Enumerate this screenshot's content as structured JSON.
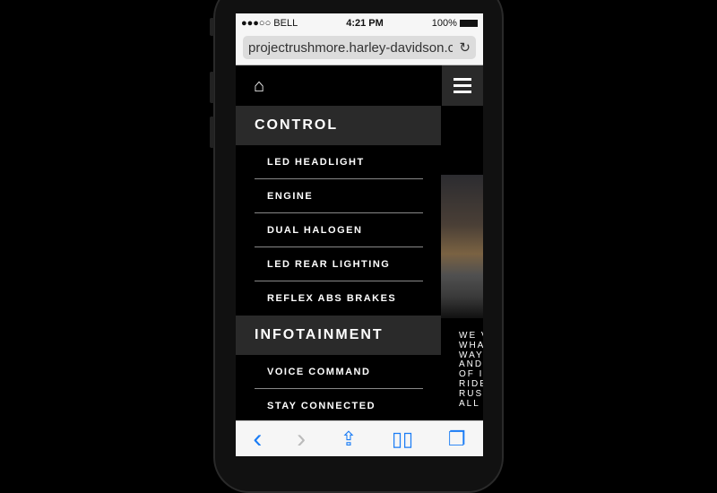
{
  "status_bar": {
    "carrier": "●●●○○ BELL",
    "time": "4:21 PM",
    "battery": "100%"
  },
  "browser": {
    "url": "projectrushmore.harley-davidson.com",
    "reload_icon": "reload-icon"
  },
  "nav": {
    "home_icon": "home-icon",
    "menu_icon": "hamburger-icon"
  },
  "menu": {
    "sections": [
      {
        "title": "CONTROL",
        "items": [
          "LED HEADLIGHT",
          "ENGINE",
          "DUAL HALOGEN",
          "LED REAR LIGHTING",
          "REFLEX ABS BRAKES"
        ]
      },
      {
        "title": "INFOTAINMENT",
        "items": [
          "VOICE COMMAND",
          "STAY CONNECTED"
        ]
      }
    ]
  },
  "content": {
    "text": "WE V\nWHA\nWAY\nAND\nOF I\nRIDE\nRUSI\nALL"
  },
  "toolbar": {
    "back": "‹",
    "forward": "›",
    "share": "share-icon",
    "bookmarks": "bookmarks-icon",
    "tabs": "tabs-icon"
  }
}
